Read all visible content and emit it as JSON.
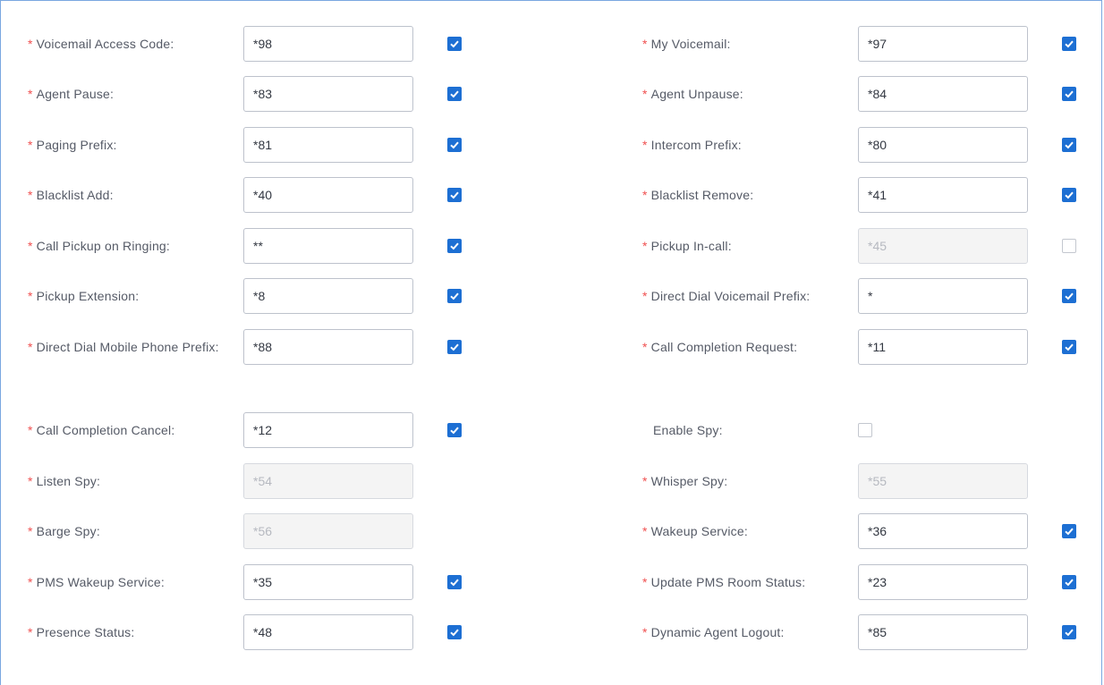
{
  "fields": {
    "voicemail_access_code": {
      "label": "Voicemail Access Code:",
      "value": "*98",
      "enabled": true
    },
    "my_voicemail": {
      "label": "My Voicemail:",
      "value": "*97",
      "enabled": true
    },
    "agent_pause": {
      "label": "Agent Pause:",
      "value": "*83",
      "enabled": true
    },
    "agent_unpause": {
      "label": "Agent Unpause:",
      "value": "*84",
      "enabled": true
    },
    "paging_prefix": {
      "label": "Paging Prefix:",
      "value": "*81",
      "enabled": true
    },
    "intercom_prefix": {
      "label": "Intercom Prefix:",
      "value": "*80",
      "enabled": true
    },
    "blacklist_add": {
      "label": "Blacklist Add:",
      "value": "*40",
      "enabled": true
    },
    "blacklist_remove": {
      "label": "Blacklist Remove:",
      "value": "*41",
      "enabled": true
    },
    "call_pickup_on_ringing": {
      "label": "Call Pickup on Ringing:",
      "value": "**",
      "enabled": true
    },
    "pickup_in_call": {
      "label": "Pickup In-call:",
      "value": "*45",
      "enabled": false
    },
    "pickup_extension": {
      "label": "Pickup Extension:",
      "value": "*8",
      "enabled": true
    },
    "direct_dial_voicemail_prefix": {
      "label": "Direct Dial Voicemail Prefix:",
      "value": "*",
      "enabled": true
    },
    "direct_dial_mobile_phone_prefix": {
      "label": "Direct Dial Mobile Phone Prefix:",
      "value": "*88",
      "enabled": true
    },
    "call_completion_request": {
      "label": "Call Completion Request:",
      "value": "*11",
      "enabled": true
    },
    "call_completion_cancel": {
      "label": "Call Completion Cancel:",
      "value": "*12",
      "enabled": true
    },
    "enable_spy": {
      "label": "Enable Spy:",
      "enabled": false
    },
    "listen_spy": {
      "label": "Listen Spy:",
      "value": "*54",
      "enabled": false
    },
    "whisper_spy": {
      "label": "Whisper Spy:",
      "value": "*55",
      "enabled": false
    },
    "barge_spy": {
      "label": "Barge Spy:",
      "value": "*56",
      "enabled": false
    },
    "wakeup_service": {
      "label": "Wakeup Service:",
      "value": "*36",
      "enabled": true
    },
    "pms_wakeup_service": {
      "label": "PMS Wakeup Service:",
      "value": "*35",
      "enabled": true
    },
    "update_pms_room_status": {
      "label": "Update PMS Room Status:",
      "value": "*23",
      "enabled": true
    },
    "presence_status": {
      "label": "Presence Status:",
      "value": "*48",
      "enabled": true
    },
    "dynamic_agent_logout": {
      "label": "Dynamic Agent Logout:",
      "value": "*85",
      "enabled": true
    }
  },
  "required_marker": "*",
  "colors": {
    "accent": "#1d6fd3",
    "required": "#f05050",
    "frame": "#7aa7e0"
  }
}
